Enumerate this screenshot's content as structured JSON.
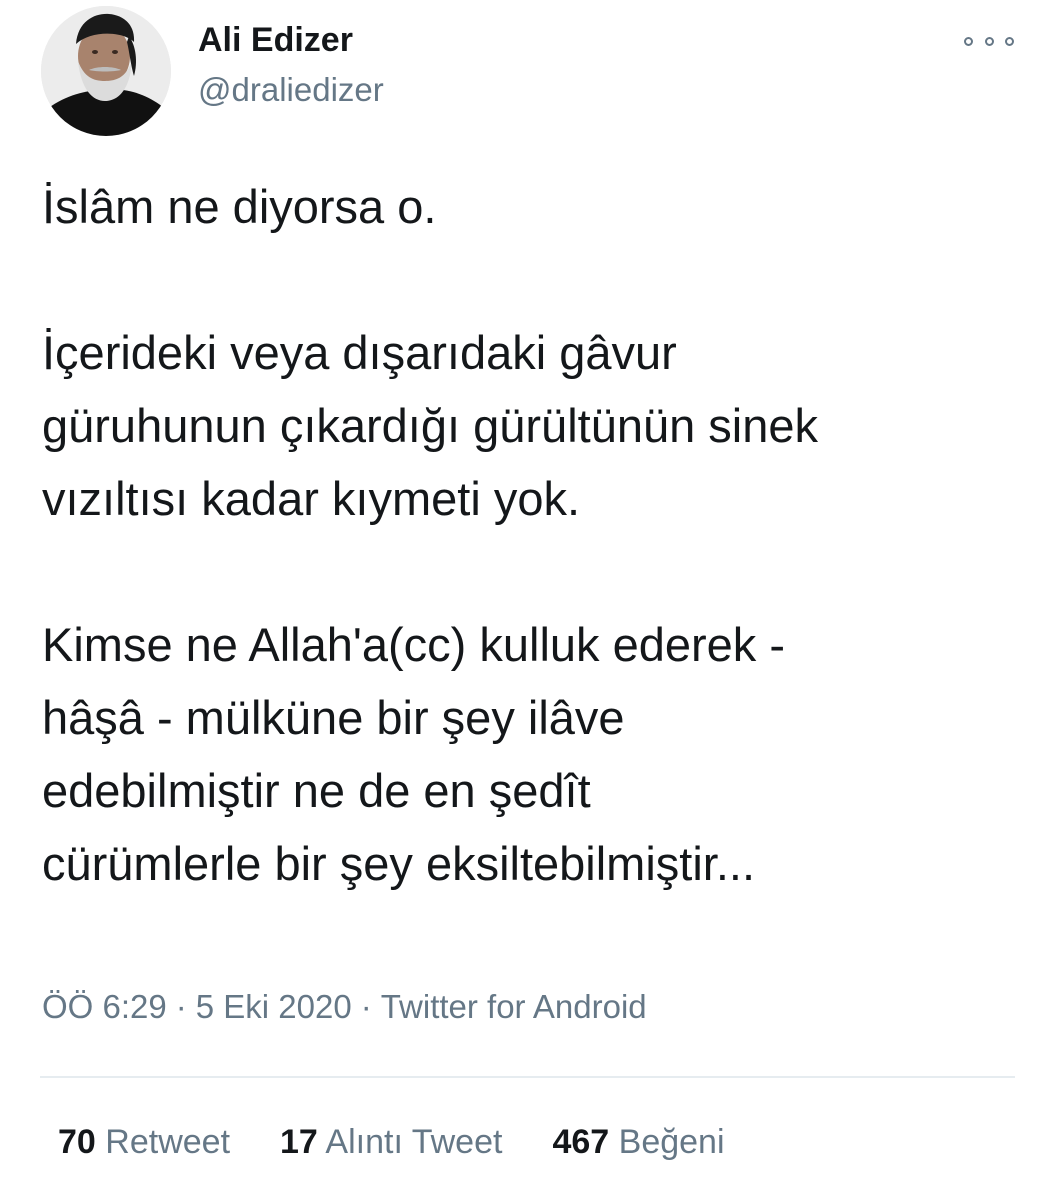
{
  "author": {
    "display_name": "Ali Edizer",
    "handle": "@draliedizer",
    "avatar_icon": "user-avatar"
  },
  "more_icon": "more-options-icon",
  "tweet": {
    "paragraphs": [
      "İslâm ne diyorsa o.",
      "İçerideki veya dışarıdaki gâvur\ngüruhunun çıkardığı gürültünün sinek\nvızıltısı kadar kıymeti yok.",
      "Kimse ne Allah'a(cc) kulluk ederek -\nhâşâ - mülküne bir şey ilâve\nedebilmiştir ne de en şedît\ncürümlerle bir şey eksiltebilmiştir..."
    ],
    "time": "ÖÖ 6:29",
    "date": "5 Eki 2020",
    "separator": "·",
    "source": "Twitter for Android"
  },
  "stats": {
    "retweets": {
      "count": "70",
      "label": "Retweet"
    },
    "quotes": {
      "count": "17",
      "label": "Alıntı Tweet"
    },
    "likes": {
      "count": "467",
      "label": "Beğeni"
    }
  },
  "colors": {
    "text": "#14171a",
    "secondary": "#657786",
    "divider": "#e6ecf0"
  }
}
